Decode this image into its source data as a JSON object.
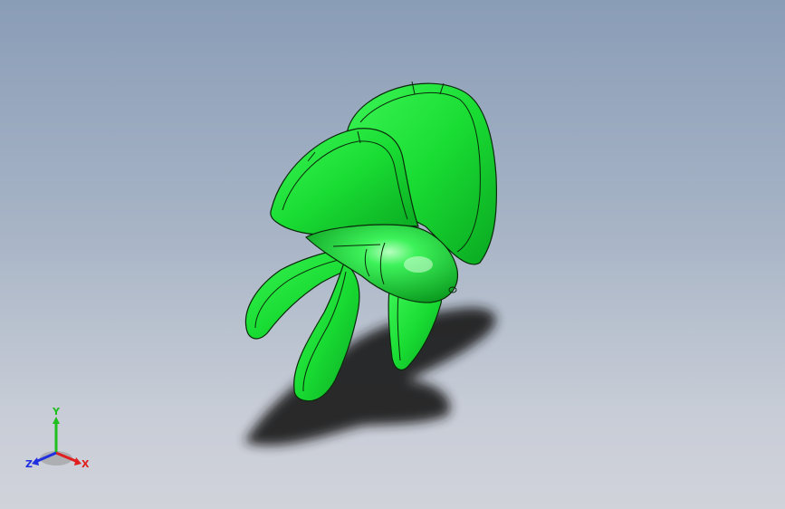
{
  "viewport": {
    "background_top": "#8a9db7",
    "background_bottom": "#d1d3db"
  },
  "model": {
    "name": "propeller-model",
    "blade_count": 5,
    "body_color": "#22e83a",
    "edge_color": "#0a2a0a"
  },
  "triad": {
    "x_label": "X",
    "y_label": "Y",
    "z_label": "Z",
    "x_color": "#e02020",
    "y_color": "#1fbf1f",
    "z_color": "#2030e0"
  }
}
